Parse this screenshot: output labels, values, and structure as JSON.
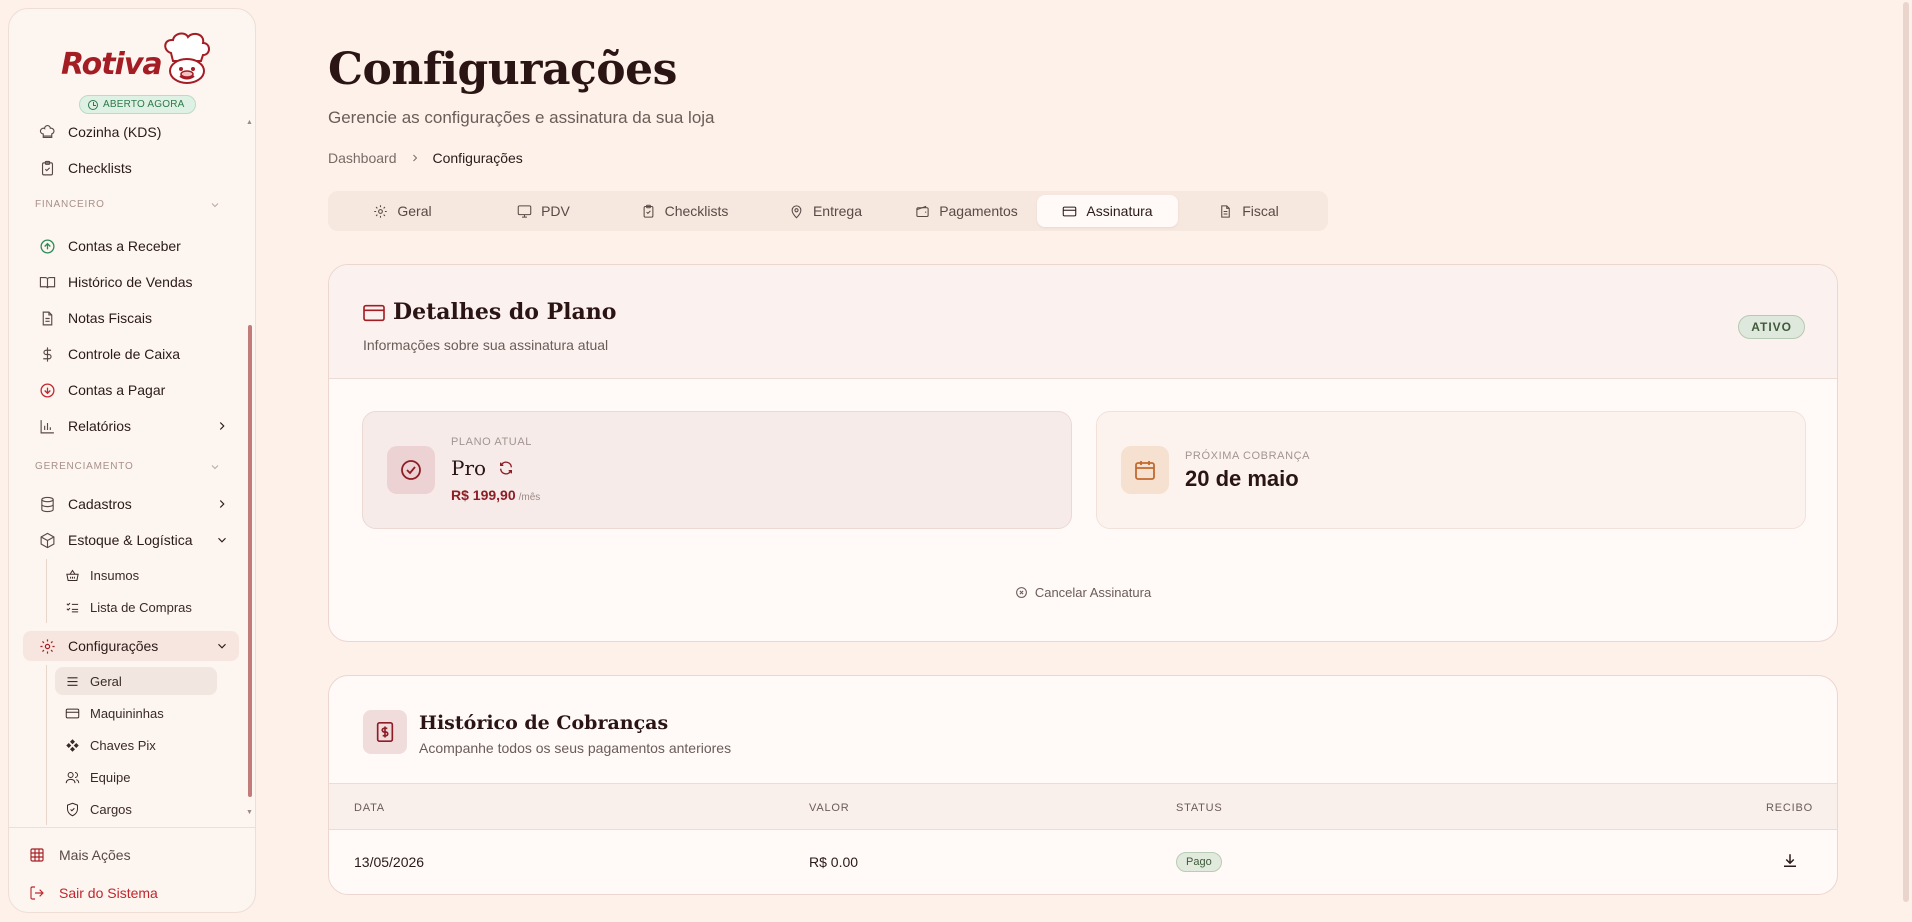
{
  "brand": {
    "name": "Rotiva",
    "status_badge": "ABERTO AGORA"
  },
  "sidebar": {
    "top_items": [
      {
        "label": "Cozinha (KDS)",
        "icon": "chef-hat-icon"
      },
      {
        "label": "Checklists",
        "icon": "clipboard-check-icon"
      }
    ],
    "financeiro": {
      "label": "FINANCEIRO",
      "items": [
        {
          "label": "Contas a Receber",
          "icon": "arrow-up-circle-icon"
        },
        {
          "label": "Histórico de Vendas",
          "icon": "book-open-icon"
        },
        {
          "label": "Notas Fiscais",
          "icon": "file-text-icon"
        },
        {
          "label": "Controle de Caixa",
          "icon": "dollar-sign-icon"
        },
        {
          "label": "Contas a Pagar",
          "icon": "arrow-down-circle-icon"
        },
        {
          "label": "Relatórios",
          "icon": "bar-chart-icon"
        }
      ]
    },
    "gerenciamento": {
      "label": "GERENCIAMENTO",
      "items": [
        {
          "label": "Cadastros",
          "icon": "database-icon"
        },
        {
          "label": "Estoque & Logística",
          "icon": "package-icon"
        }
      ],
      "estoque_sub": [
        {
          "label": "Insumos",
          "icon": "basket-icon"
        },
        {
          "label": "Lista de Compras",
          "icon": "list-checks-icon"
        }
      ],
      "config": {
        "label": "Configurações",
        "icon": "gear-icon"
      },
      "config_sub": [
        {
          "label": "Geral",
          "icon": "menu-icon"
        },
        {
          "label": "Maquininhas",
          "icon": "credit-card-icon"
        },
        {
          "label": "Chaves Pix",
          "icon": "pix-icon"
        },
        {
          "label": "Equipe",
          "icon": "users-icon"
        },
        {
          "label": "Cargos",
          "icon": "shield-icon"
        }
      ]
    },
    "footer": {
      "more_actions": "Mais Ações",
      "logout": "Sair do Sistema"
    }
  },
  "header": {
    "title": "Configurações",
    "subtitle": "Gerencie as configurações e assinatura da sua loja",
    "breadcrumb": [
      "Dashboard",
      "Configurações"
    ]
  },
  "tabs": [
    {
      "label": "Geral",
      "icon": "gear-icon"
    },
    {
      "label": "PDV",
      "icon": "monitor-icon"
    },
    {
      "label": "Checklists",
      "icon": "clipboard-check-icon"
    },
    {
      "label": "Entrega",
      "icon": "map-pin-icon"
    },
    {
      "label": "Pagamentos",
      "icon": "wallet-icon"
    },
    {
      "label": "Assinatura",
      "icon": "credit-card-icon"
    },
    {
      "label": "Fiscal",
      "icon": "file-text-icon"
    }
  ],
  "active_tab": "Assinatura",
  "plan": {
    "title": "Detalhes do Plano",
    "description": "Informações sobre sua assinatura atual",
    "status": "ATIVO",
    "current_label": "PLANO ATUAL",
    "current_name": "Pro",
    "price": "R$ 199,90",
    "price_unit": "/mês",
    "next_label": "PRÓXIMA COBRANÇA",
    "next_date": "20 de maio",
    "cancel_label": "Cancelar Assinatura"
  },
  "history": {
    "title": "Histórico de Cobranças",
    "description": "Acompanhe todos os seus pagamentos anteriores",
    "columns": [
      "DATA",
      "VALOR",
      "STATUS",
      "RECIBO"
    ],
    "rows": [
      {
        "date": "13/05/2026",
        "value": "R$ 0.00",
        "status": "Pago"
      }
    ]
  },
  "colors": {
    "background": "#fdf1ea",
    "brand": "#a51d24",
    "status_green": "#2c7a48",
    "price": "#8e1d26"
  }
}
